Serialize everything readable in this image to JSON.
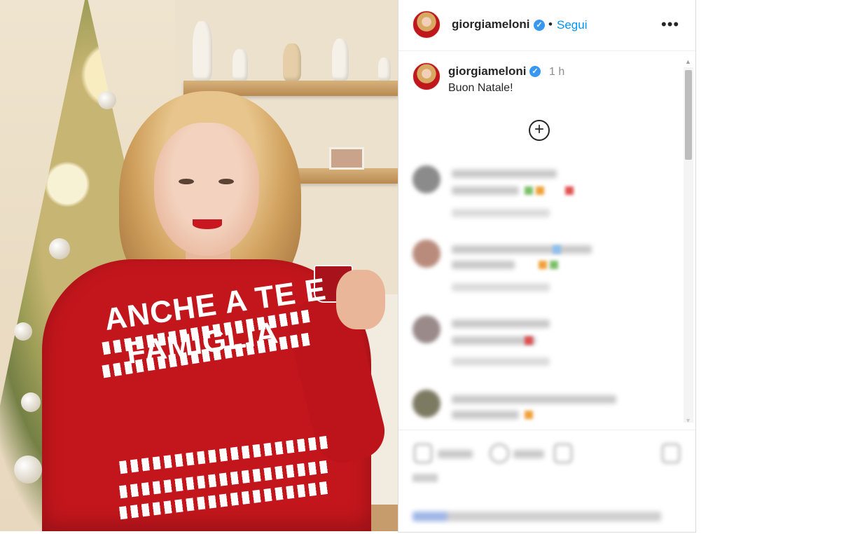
{
  "post": {
    "header": {
      "username": "giorgiameloni",
      "verified_glyph": "✓",
      "separator": "•",
      "follow_label": "Segui",
      "more_label": "•••"
    },
    "caption": {
      "username": "giorgiameloni",
      "verified_glyph": "✓",
      "timestamp": "1 h",
      "text": "Buon Natale!"
    },
    "load_more_icon": "plus-circle-icon",
    "load_more_glyph": "+",
    "photo": {
      "sweater_line_1": "ANCHE A TE E",
      "sweater_line_2": "FAMIGLIA"
    },
    "comments_blurred": 4
  },
  "colors": {
    "accent_link": "#0095f6",
    "verified_badge": "#3897f0",
    "text_primary": "#262626",
    "text_secondary": "#8e8e8e",
    "sweater_red": "#c3161c"
  }
}
